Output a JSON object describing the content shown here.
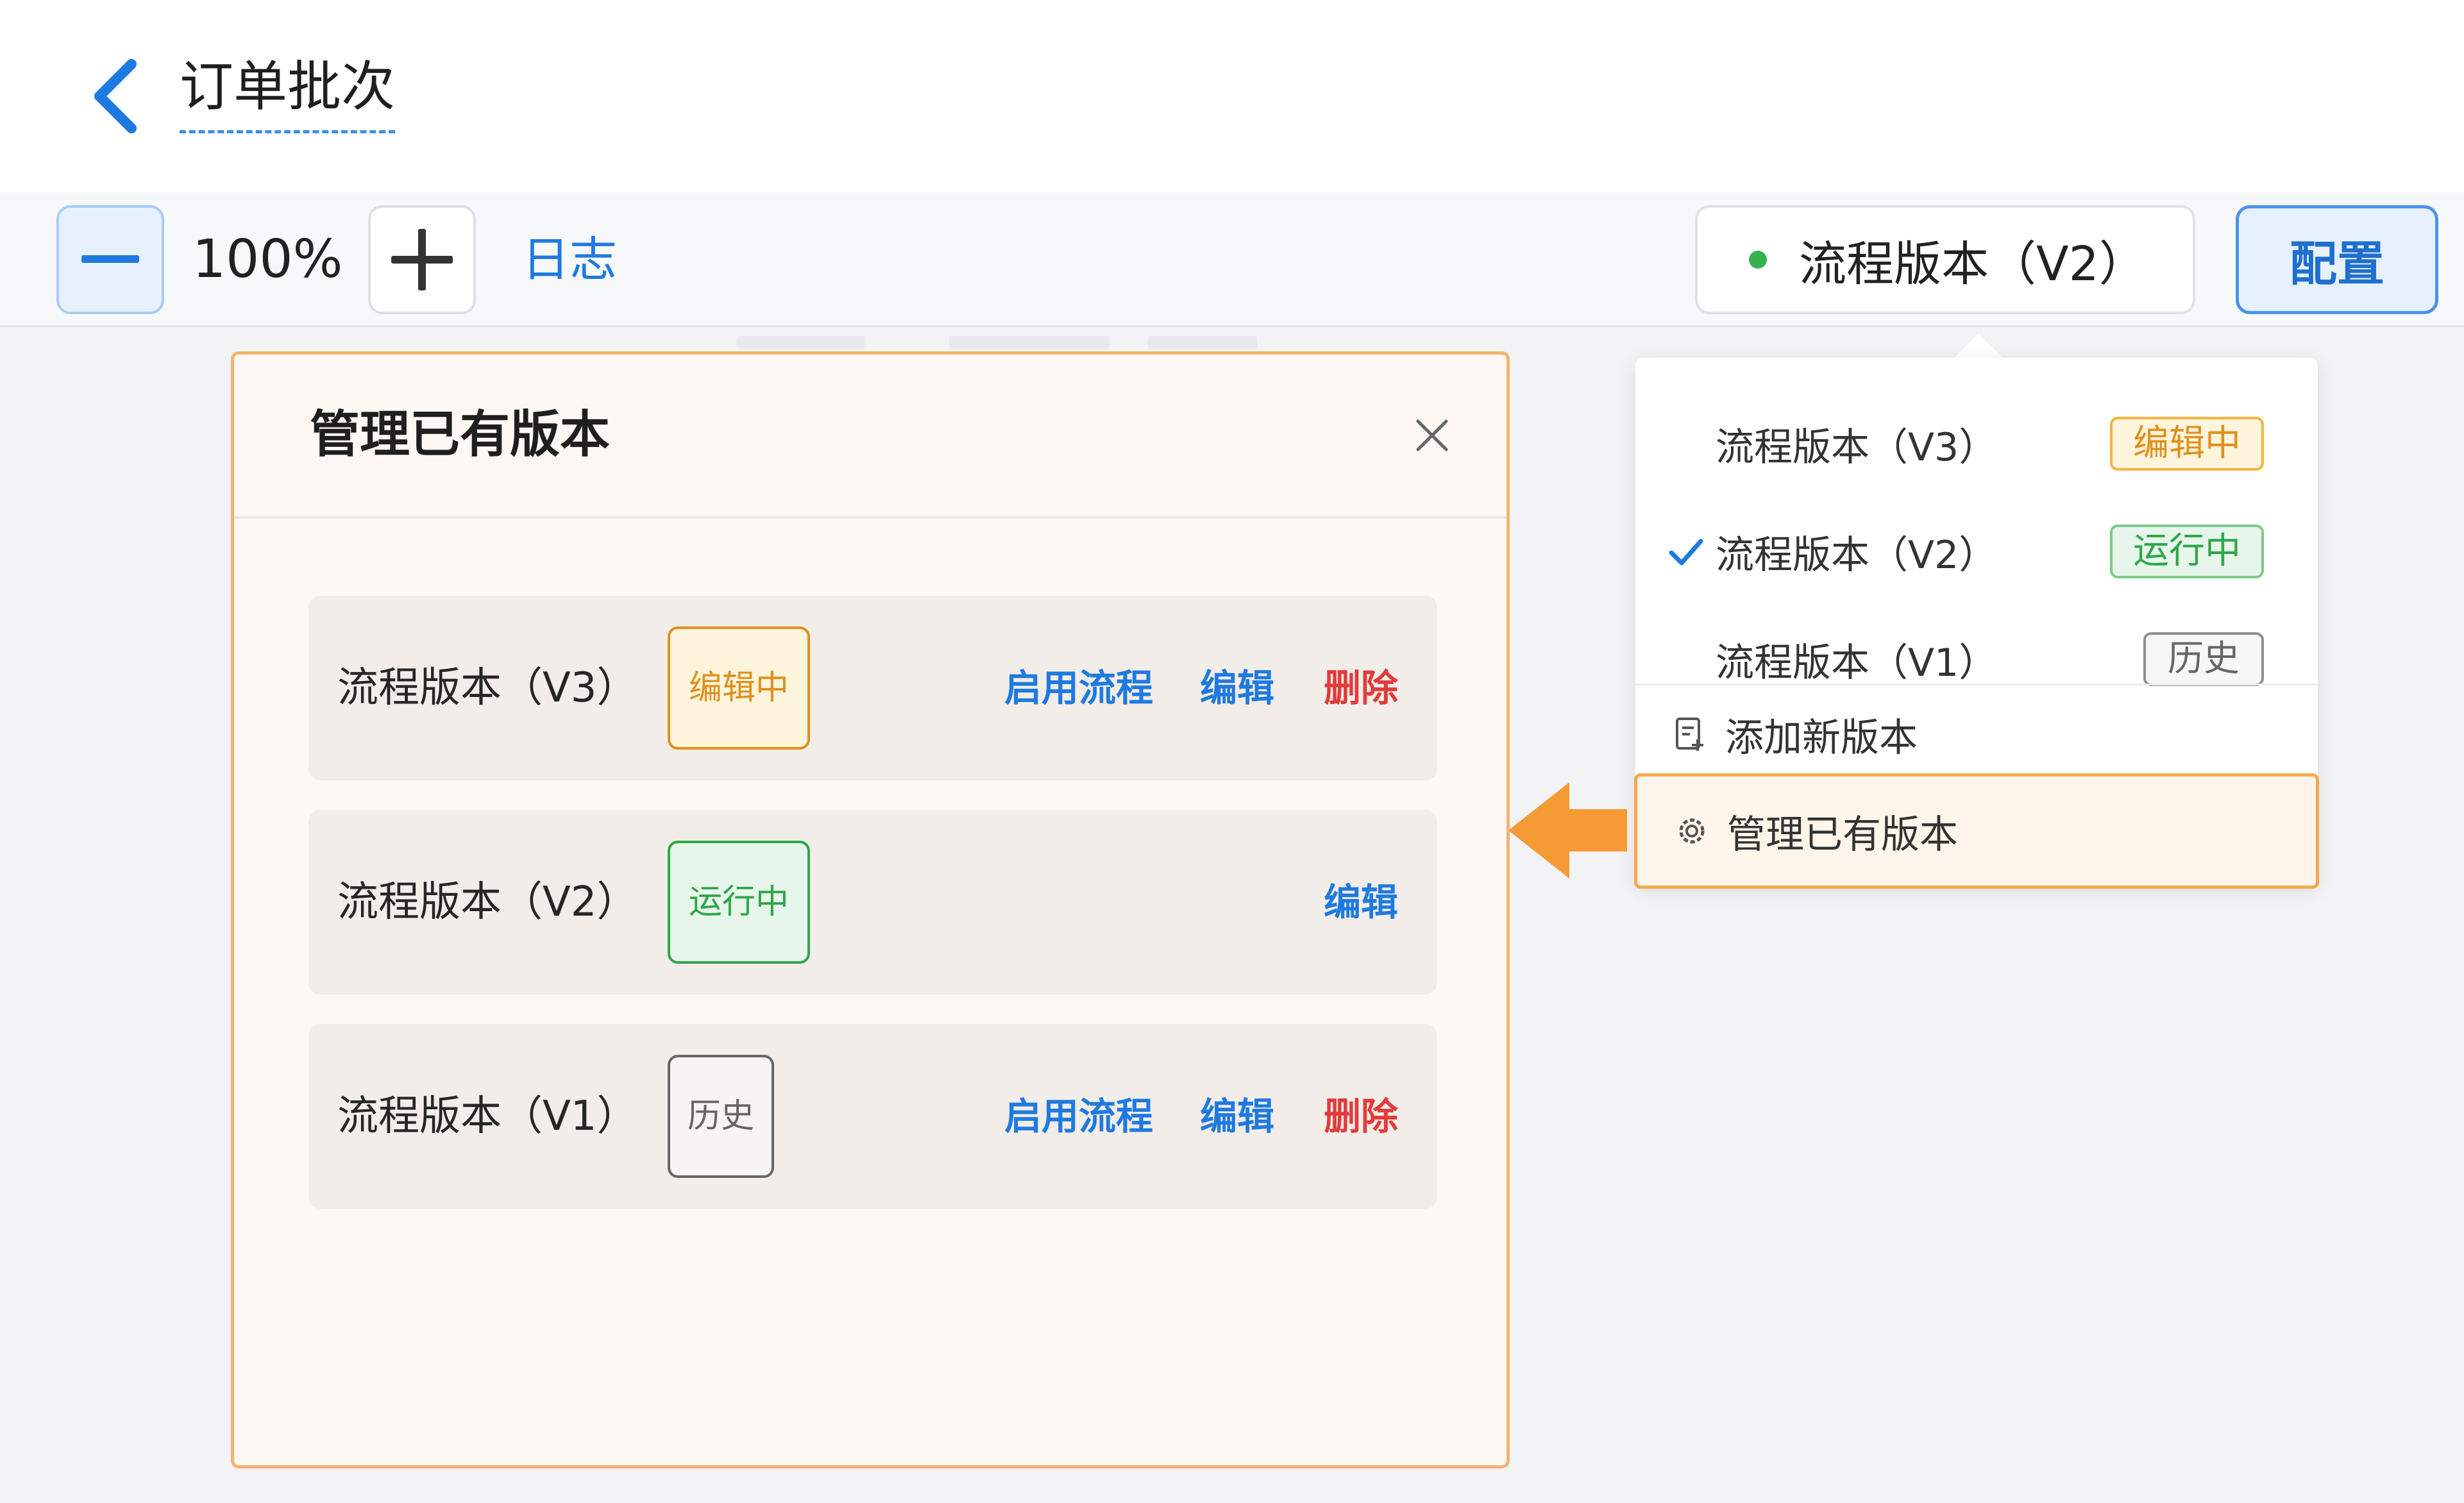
{
  "header": {
    "title": "订单批次",
    "back_icon": "chevron-left-icon"
  },
  "toolbar": {
    "zoom_level": "100%",
    "log_label": "日志",
    "version_select_label": "流程版本（V2）",
    "config_label": "配置",
    "accent_color": "#1f7ae0"
  },
  "dropdown": {
    "items": [
      {
        "label": "流程版本（V3）",
        "tag": "编辑中",
        "selected": false
      },
      {
        "label": "流程版本（V2）",
        "tag": "运行中",
        "selected": true
      },
      {
        "label": "流程版本（V1）",
        "tag": "历史",
        "selected": false
      }
    ],
    "actions": [
      {
        "label": "添加新版本",
        "icon": "add-document-icon"
      },
      {
        "label": "管理已有版本",
        "icon": "gear-icon"
      }
    ]
  },
  "modal": {
    "title": "管理已有版本",
    "rows": [
      {
        "name": "流程版本（V3）",
        "tag": "编辑中",
        "actions": [
          "启用流程",
          "编辑",
          "删除"
        ]
      },
      {
        "name": "流程版本（V2）",
        "tag": "运行中",
        "actions": [
          "编辑"
        ]
      },
      {
        "name": "流程版本（V1）",
        "tag": "历史",
        "actions": [
          "启用流程",
          "编辑",
          "删除"
        ]
      }
    ]
  },
  "colors": {
    "editing": "#e0901b",
    "running": "#2fa64a",
    "history": "#666666",
    "delete": "#e23b3b",
    "highlight": "#f5a94c"
  }
}
